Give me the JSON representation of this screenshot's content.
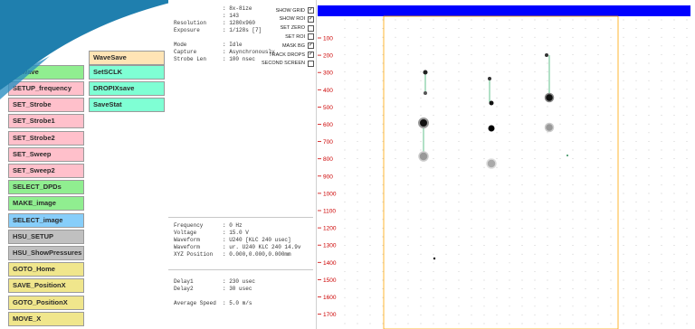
{
  "buttons_col1": [
    {
      "label": "SETUP_frequency",
      "color": "pink"
    },
    {
      "label": "SET_Strobe",
      "color": "pink"
    },
    {
      "label": "SET_Strobe1",
      "color": "pink"
    },
    {
      "label": "SET_Strobe2",
      "color": "pink"
    },
    {
      "label": "SET_Sweep",
      "color": "pink"
    },
    {
      "label": "SET_Sweep2",
      "color": "pink"
    },
    {
      "label": "SELECT_DPDs",
      "color": "green"
    },
    {
      "label": "MAKE_image",
      "color": "green"
    },
    {
      "label": "SELECT_image",
      "color": "blue"
    },
    {
      "label": "HSU_SETUP",
      "color": "gray"
    },
    {
      "label": "HSU_ShowPressures",
      "color": "gray"
    },
    {
      "label": "GOTO_Home",
      "color": "yellow"
    },
    {
      "label": "SAVE_PositionX",
      "color": "yellow"
    },
    {
      "label": "GOTO_PositionX",
      "color": "yellow"
    },
    {
      "label": "MOVE_X",
      "color": "yellow"
    }
  ],
  "partial_button": {
    "label": "..._wave"
  },
  "buttons_col2": [
    {
      "label": "WaveSave",
      "color": "peach"
    },
    {
      "label": "SetSCLK",
      "color": "mint"
    },
    {
      "label": "DROPIXsave",
      "color": "mint"
    },
    {
      "label": "SaveStat",
      "color": "mint"
    }
  ],
  "info_top": {
    "line1": "               : 8x-8ize",
    "line2": "               : 143",
    "line3": "Resolution     : 1280x960",
    "line4": "Exposure       : 1/128s [7]",
    "line5": "Mode           : Idle",
    "line6": "Capture        : Asynchronously",
    "line7": "Strobe Len     : 100 nsec"
  },
  "checkboxes": [
    {
      "label": "SHOW GRID",
      "checked": true
    },
    {
      "label": "SHOW ROI",
      "checked": true
    },
    {
      "label": "SET ZERO",
      "checked": false
    },
    {
      "label": "SET ROI",
      "checked": false
    },
    {
      "label": "MASK BG",
      "checked": true
    },
    {
      "label": "TRACK DROPS",
      "checked": true
    },
    {
      "label": "SECOND SCREEN",
      "checked": false
    }
  ],
  "check_mark": "✓",
  "info_mid": {
    "line1": "Frequency      : 0 Hz",
    "line2": "Voltage        : 15.0 V",
    "line3": "Waveform       : U240 [KLC 240 usec]",
    "line4": "Waveform       : ur. U240 KLC 240 14.9v",
    "line5": "XYZ Position   : 0.000,0.000,0.000mm"
  },
  "info_bottom": {
    "line1": "Delay1         : 230 usec",
    "line2": "Delay2         : 30 usec",
    "line3": "Average Speed  : 5.0 m/s"
  },
  "y_ticks": [
    "100",
    "200",
    "300",
    "400",
    "500",
    "600",
    "700",
    "800",
    "900",
    "1000",
    "1100",
    "1200",
    "1300",
    "1400",
    "1500",
    "1600",
    "1700"
  ],
  "colors": {
    "topbar": "#0000ff",
    "roi": "#ffa500",
    "tick_text": "#cc0000",
    "wedge": "#1f7fae"
  }
}
